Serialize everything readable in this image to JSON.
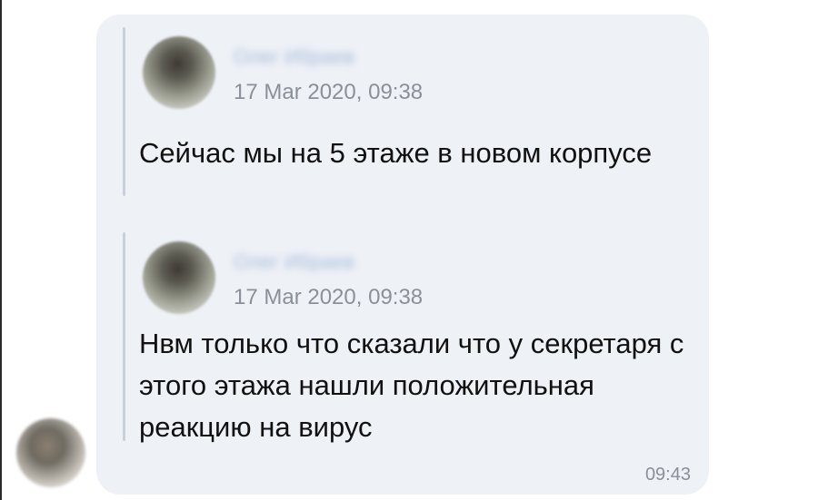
{
  "messages": [
    {
      "author": "Олег Ибраев",
      "date": "17 Mar 2020, 09:38",
      "text": "Сейчас мы на 5 этаже в новом корпусе"
    },
    {
      "author": "Олег Ибраев",
      "date": "17 Mar 2020, 09:38",
      "text": "Нвм только что сказали что у секретаря с этого этажа нашли положительная реакцию на вирус"
    }
  ],
  "bubble": {
    "time": "09:43"
  },
  "colors": {
    "bubble_bg": "#eef1f6",
    "quote_bar": "#c9d0dc",
    "muted_text": "#8a9099",
    "author_name": "#6b8fc2",
    "message_text": "#111111"
  }
}
